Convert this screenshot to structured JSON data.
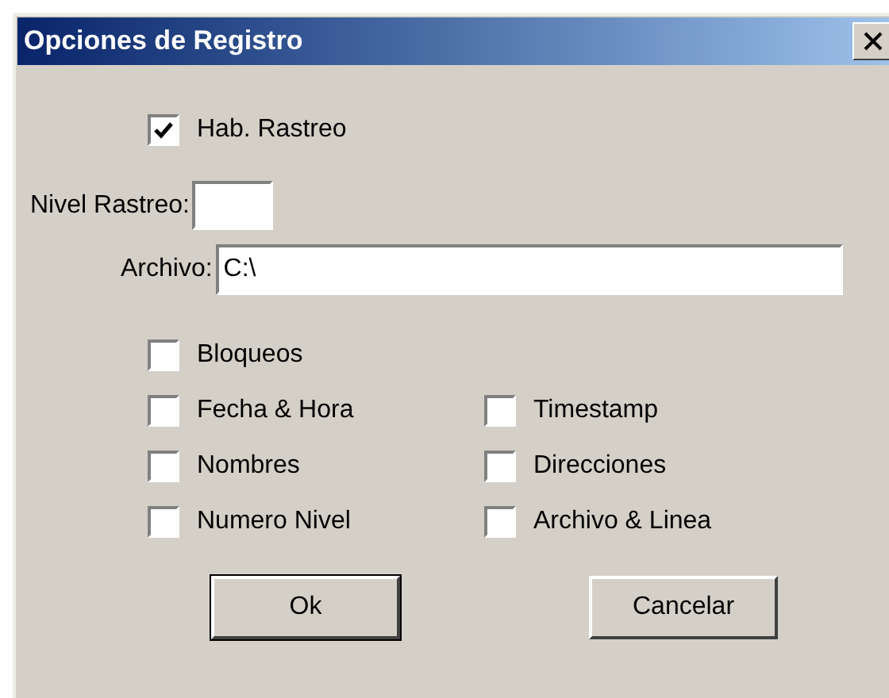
{
  "window": {
    "title": "Opciones de Registro"
  },
  "enable_trace": {
    "label": "Hab. Rastreo",
    "checked": true
  },
  "trace_level": {
    "label": "Nivel Rastreo:"
  },
  "file": {
    "label": "Archivo:",
    "value": "C:\\"
  },
  "option_rows": [
    [
      {
        "label": "Bloqueos",
        "checked": false
      }
    ],
    [
      {
        "label": "Fecha & Hora",
        "checked": false
      },
      {
        "label": "Timestamp",
        "checked": false
      }
    ],
    [
      {
        "label": "Nombres",
        "checked": false
      },
      {
        "label": "Direcciones",
        "checked": false
      }
    ],
    [
      {
        "label": "Numero Nivel",
        "checked": false
      },
      {
        "label": "Archivo & Linea",
        "checked": false
      }
    ]
  ],
  "buttons": [
    {
      "label": "Ok",
      "default": true
    },
    {
      "label": "Cancelar",
      "default": false
    }
  ]
}
